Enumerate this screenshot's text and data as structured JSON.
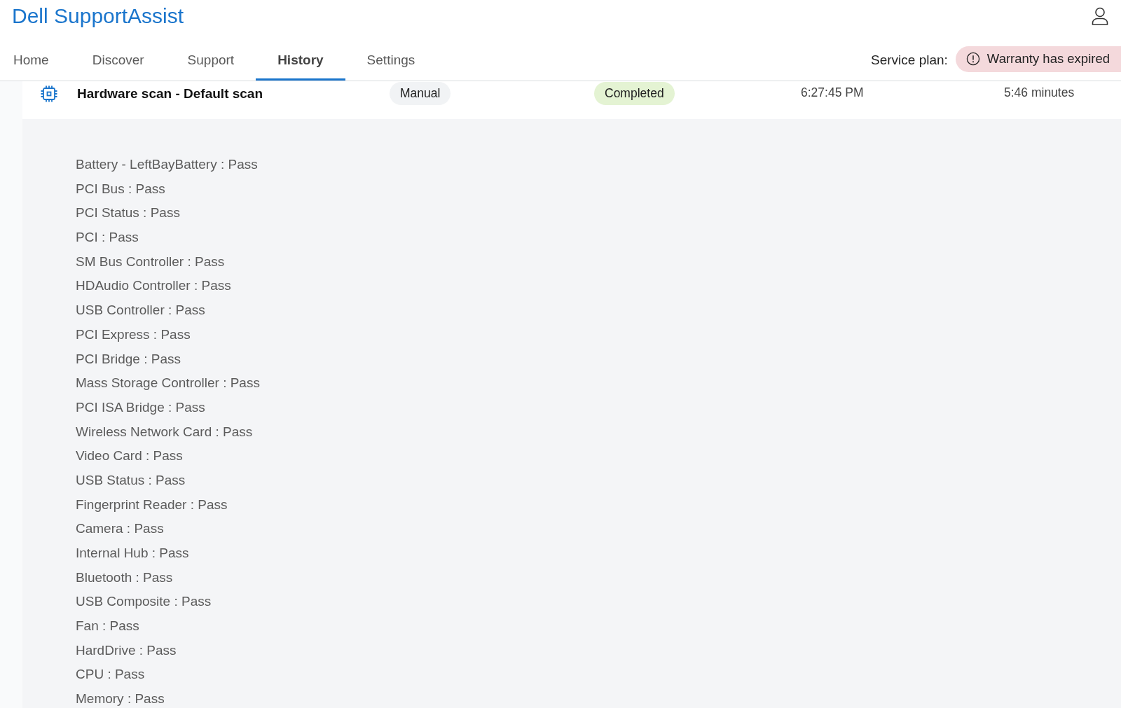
{
  "app": {
    "title": "Dell SupportAssist"
  },
  "tabs": [
    {
      "label": "Home",
      "selected": false
    },
    {
      "label": "Discover",
      "selected": false
    },
    {
      "label": "Support",
      "selected": false
    },
    {
      "label": "History",
      "selected": true
    },
    {
      "label": "Settings",
      "selected": false
    }
  ],
  "service_plan": {
    "label": "Service plan:",
    "status": "Warranty has expired"
  },
  "scan": {
    "title": "Hardware scan - Default scan",
    "type": "Manual",
    "status": "Completed",
    "time": "6:27:45 PM",
    "duration": "5:46 minutes"
  },
  "results": [
    "Battery - LeftBayBattery : Pass",
    "PCI Bus : Pass",
    "PCI Status : Pass",
    "PCI : Pass",
    "SM Bus Controller : Pass",
    "HDAudio Controller : Pass",
    "USB Controller : Pass",
    "PCI Express : Pass",
    "PCI Bridge : Pass",
    "Mass Storage Controller : Pass",
    "PCI ISA Bridge : Pass",
    "Wireless Network Card : Pass",
    "Video Card : Pass",
    "USB Status : Pass",
    "Fingerprint Reader : Pass",
    "Camera : Pass",
    "Internal Hub : Pass",
    "Bluetooth : Pass",
    "USB Composite : Pass",
    "Fan : Pass",
    "HardDrive : Pass",
    "CPU : Pass",
    "Memory : Pass"
  ]
}
